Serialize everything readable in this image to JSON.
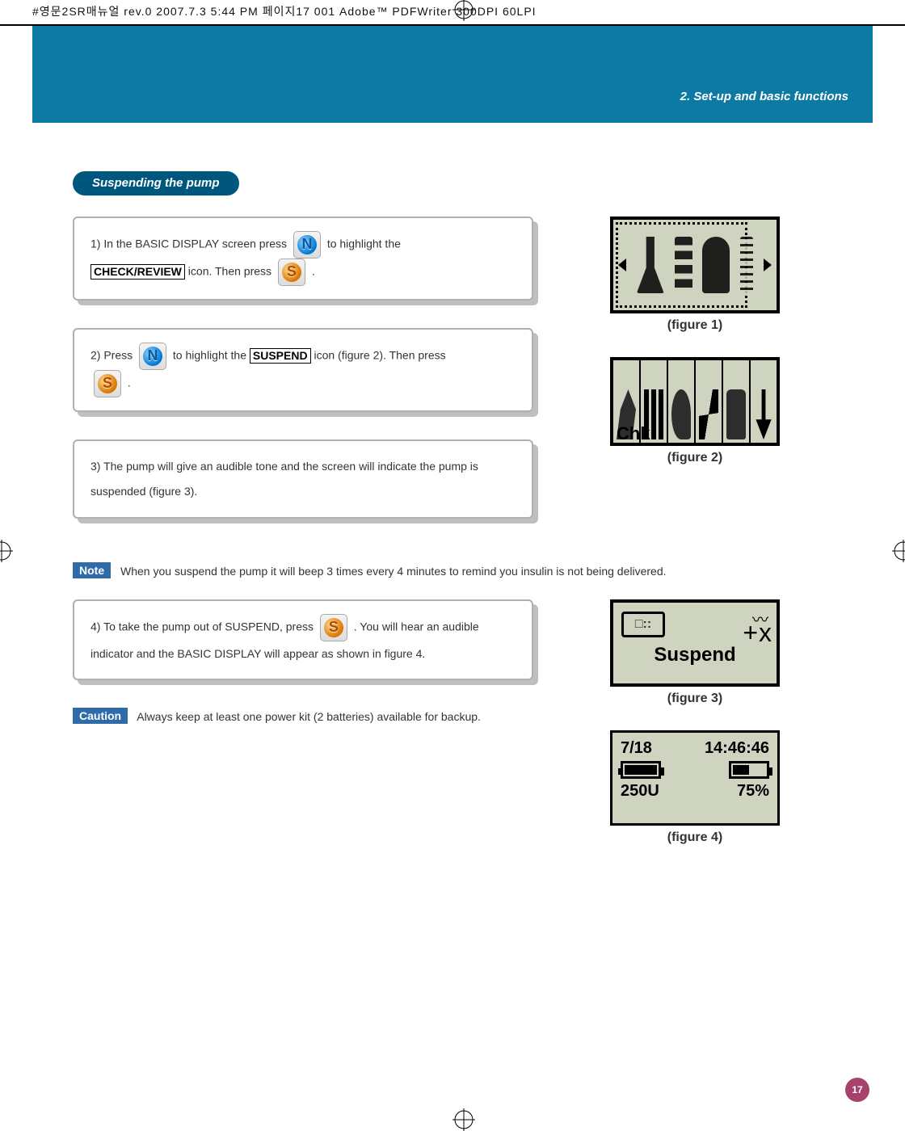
{
  "print_header": "#영문2SR매뉴얼 rev.0  2007.7.3 5:44 PM  페이지17   001 Adobe™ PDFWriter 300DPI 60LPI",
  "breadcrumb": "2. Set-up and basic functions",
  "section_title": "Suspending the pump",
  "steps": {
    "s1_a": "1) In the BASIC DISPLAY screen press ",
    "s1_b": " to highlight the ",
    "s1_boxed": "CHECK/REVIEW",
    "s1_c": " icon. Then press ",
    "s1_d": " .",
    "s2_a": "2) Press ",
    "s2_b": " to highlight the ",
    "s2_boxed": "SUSPEND",
    "s2_c": " icon (figure 2). Then press ",
    "s2_d": " .",
    "s3": "3) The pump will give an audible tone and the screen will indicate the pump is suspended (figure 3).",
    "s4_a": "4) To take the pump out of SUSPEND, press ",
    "s4_b": " . You will hear an audible indicator and the BASIC DISPLAY will appear as shown in figure 4."
  },
  "note_label": "Note",
  "note_text": "When you suspend the pump it will beep 3 times every 4 minutes to remind you insulin is not being delivered.",
  "caution_label": "Caution",
  "caution_text": "Always keep at least one power kit (2 batteries) available for backup.",
  "figures": {
    "f1": "(figure 1)",
    "f2_label": "Chk",
    "f2": "(figure 2)",
    "f3_text": "Suspend",
    "f3_dots": "□::",
    "f3_plusx": "+ x",
    "f3": "(figure 3)",
    "f4_date": "7/18",
    "f4_time": "14:46:46",
    "f4_units": "250U",
    "f4_pct": "75%",
    "f4": "(figure 4)"
  },
  "buttons": {
    "n": "N",
    "s": "S"
  },
  "page_number": "17"
}
